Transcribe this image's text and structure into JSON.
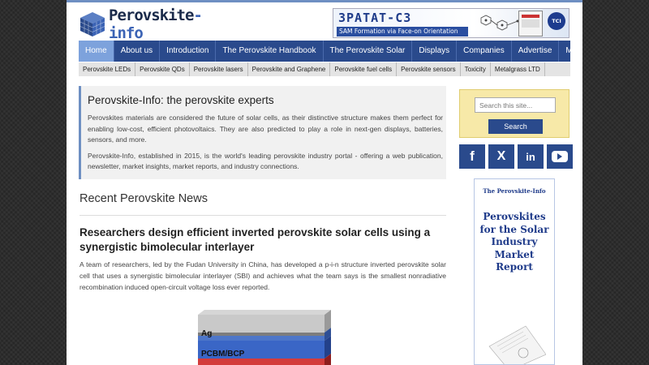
{
  "logo": {
    "text_main": "Perovskite",
    "text_accent": "-info"
  },
  "banner": {
    "title": "ЗРАТАТ-С3",
    "subtitle": "SAM Formation via Face-on Orientation",
    "badge": "TCI"
  },
  "nav": {
    "items": [
      "Home",
      "About us",
      "Introduction",
      "The Perovskite Handbook",
      "The Perovskite Solar",
      "Displays",
      "Companies",
      "Advertise",
      "More"
    ],
    "active": "Home"
  },
  "subnav": {
    "items": [
      "Perovskite LEDs",
      "Perovskite QDs",
      "Perovskite lasers",
      "Perovskite and Graphene",
      "Perovskite fuel cells",
      "Perovskite sensors",
      "Toxicity",
      "Metalgrass LTD"
    ]
  },
  "intro": {
    "title": "Perovskite-Info: the perovskite experts",
    "p1": "Perovskites materials are considered the future of solar cells, as their distinctive structure makes them perfect for enabling low-cost, efficient photovoltaics. They are also predicted to play a role in next-gen displays, batteries, sensors, and more.",
    "p2": "Perovskite-Info, established in 2015, is the world's leading perovskite industry portal - offering a web publication, newsletter, market insights, market reports, and industry connections."
  },
  "news": {
    "heading": "Recent Perovskite News",
    "article_title": "Researchers design efficient inverted perovskite solar cells using a synergistic bimolecular interlayer",
    "article_text": "A team of researchers, led by the Fudan University in China, has developed a p-i-n structure inverted perovskite solar cell that uses a synergistic bimolecular interlayer (SBI) and achieves what the team says is the smallest nonradiative recombination induced open-circuit voltage loss ever reported.",
    "figure_layers": [
      "Ag",
      "PCBM/BCP"
    ]
  },
  "sidebar": {
    "search_placeholder": "Search this site...",
    "search_button": "Search",
    "social": [
      "f",
      "X",
      "in",
      "▶"
    ],
    "ad_top": "The Perovskite-Info",
    "ad_main": "Perovskites for the Solar Industry Market Report"
  },
  "colors": {
    "nav_bg": "#2a4a8c",
    "nav_active": "#7da2dc",
    "search_bg": "#f7e9a8",
    "intro_border": "#6e8fc2"
  }
}
